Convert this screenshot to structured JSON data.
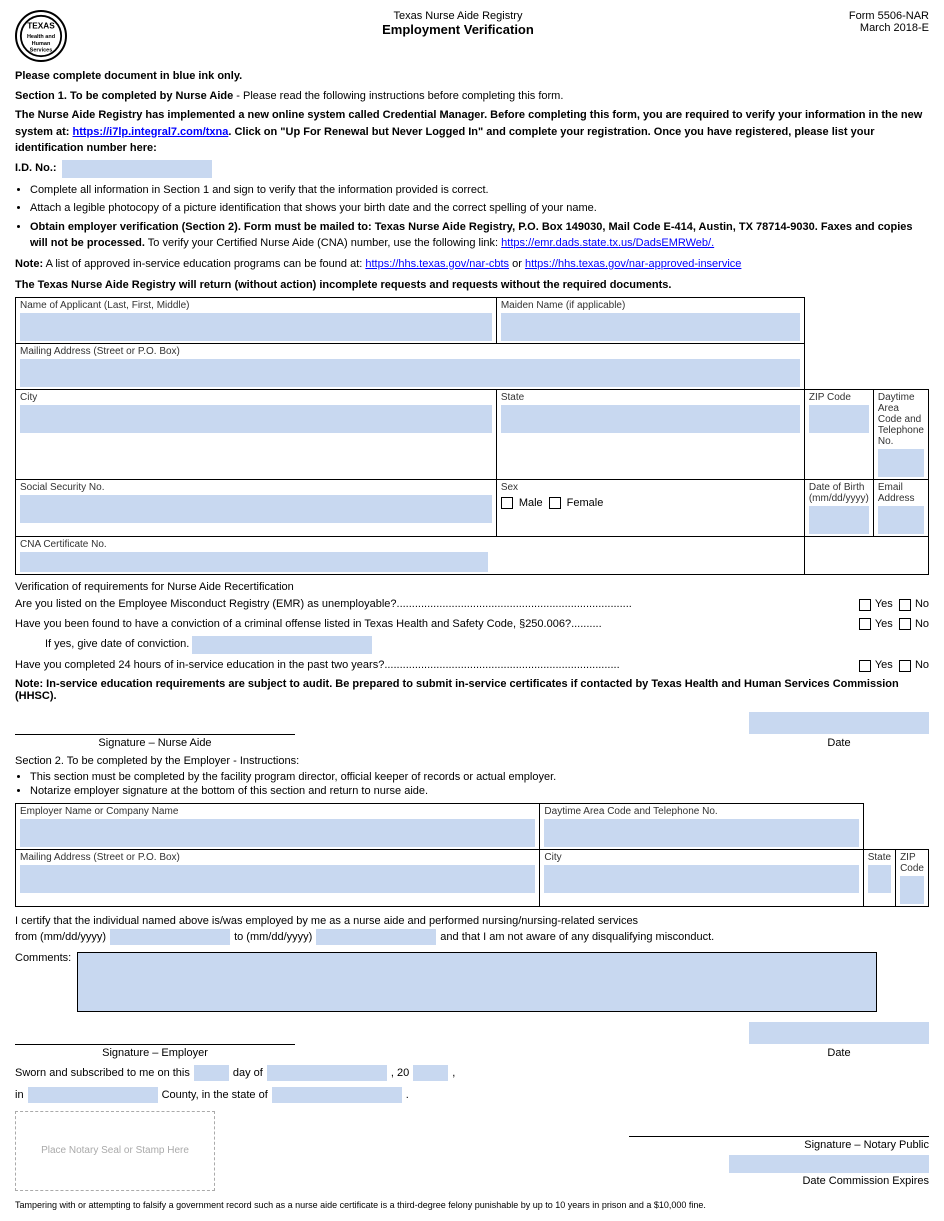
{
  "header": {
    "logo_text": "TEXAS",
    "logo_sub": "Health and Human\nServices",
    "form_number": "Form 5506-NAR",
    "form_date": "March 2018-E",
    "registry_title": "Texas Nurse Aide Registry",
    "form_title": "Employment Verification"
  },
  "instructions": {
    "line1": "Please complete document in blue ink only.",
    "line2_bold": "Section 1. To be completed by Nurse Aide",
    "line2_rest": " - Please read the following instructions before completing this form.",
    "line3": "The Nurse Aide Registry has implemented a new online system called Credential Manager. Before completing this form, you are required to verify your information in the new system at: ",
    "link1": "https://i7lp.integral7.com/txna",
    "line3b": ". Click on \"Up For Renewal but Never Logged In\" and complete your registration. Once you have registered, please list your identification number here:",
    "id_label": "I.D. No.:",
    "bullet1": "Complete all information in Section 1 and sign to verify that the information provided is correct.",
    "bullet2": "Attach a legible photocopy of a picture identification that shows your birth date and the correct spelling of your name.",
    "bullet3_bold": "Obtain employer verification (Section 2). Form must be mailed to: Texas Nurse Aide Registry, P.O. Box 149030, Mail Code E-414, Austin, TX 78714-9030. Faxes and copies will not be processed.",
    "bullet3_rest": " To verify your Certified Nurse Aide (CNA) number, use the following link:",
    "link2": "https://emr.dads.state.tx.us/DadsEMRWeb/.",
    "note": "Note:",
    "note_text": " A list of approved in-service education programs can be found at: ",
    "link3": "https://hhs.texas.gov/nar-cbts",
    "note_or": " or ",
    "link4": "https://hhs.texas.gov/nar-approved-inservice",
    "warning": "The Texas Nurse Aide Registry will return (without action) incomplete requests and requests without the required documents."
  },
  "section1": {
    "fields": {
      "name_label": "Name of Applicant (Last, First, Middle)",
      "maiden_label": "Maiden Name (if applicable)",
      "address_label": "Mailing Address (Street or P.O. Box)",
      "city_label": "City",
      "state_label": "State",
      "zip_label": "ZIP Code",
      "daytime_label": "Daytime Area Code and Telephone No.",
      "ssn_label": "Social Security No.",
      "sex_label": "Sex",
      "male_label": "Male",
      "female_label": "Female",
      "dob_label": "Date of Birth (mm/dd/yyyy)",
      "email_label": "Email Address",
      "cna_label": "CNA Certificate No."
    }
  },
  "verification": {
    "title": "Verification of requirements for Nurse Aide Recertification",
    "q1": "Are you listed on the Employee Misconduct Registry (EMR) as unemployable?.............................................................................",
    "q1_yes": "Yes",
    "q1_no": "No",
    "q2": "Have you been found to have a conviction of a criminal offense listed in Texas Health and Safety Code, §250.006?..........",
    "q2_yes": "Yes",
    "q2_no": "No",
    "q2_sub": "If yes, give date of conviction.",
    "q3": "Have you completed 24 hours of in-service education in the past two years?.............................................................................",
    "q3_yes": "Yes",
    "q3_no": "No",
    "note": "Note: In-service education requirements are subject to audit. Be prepared to submit in-service certificates if contacted by Texas Health and Human Services Commission (HHSC).",
    "sig_label": "Signature – Nurse Aide",
    "date_label": "Date"
  },
  "section2": {
    "header_bold": "Section 2. To be completed by the Employer",
    "header_rest": " - Instructions:",
    "bullet1": "This section must be completed by the facility program director, official keeper of records or actual employer.",
    "bullet2": "Notarize employer signature at the bottom of this section and return to nurse aide.",
    "fields": {
      "employer_label": "Employer Name or Company Name",
      "daytime_label": "Daytime Area Code and Telephone No.",
      "address_label": "Mailing Address (Street or P.O. Box)",
      "city_label": "City",
      "state_label": "State",
      "zip_label": "ZIP Code"
    },
    "certify_text1": "I certify that the individual named above is/was employed by me as a ",
    "certify_bold": "nurse aide and performed nursing/nursing-related services",
    "certify_text2": "from (mm/dd/yyyy)",
    "certify_text3": "to (mm/dd/yyyy)",
    "certify_text4": "and that I am not aware of any disqualifying misconduct.",
    "comments_label": "Comments:",
    "sig_label": "Signature – Employer",
    "date_label": "Date",
    "sworn_text1": "Sworn and subscribed to me on this",
    "sworn_text2": "day of",
    "sworn_text3": ", 20",
    "sworn_text4": ",",
    "sworn_text5": "in",
    "sworn_text6": "County, in the state of",
    "notary_seal": "Place Notary Seal or Stamp Here",
    "notary_sig": "Signature – Notary Public",
    "date_commission": "Date Commission Expires"
  },
  "footer": {
    "text": "Tampering with or attempting to falsify a government record such as a nurse aide certificate is a third-degree felony punishable by up to 10 years in prison and a $10,000 fine."
  }
}
